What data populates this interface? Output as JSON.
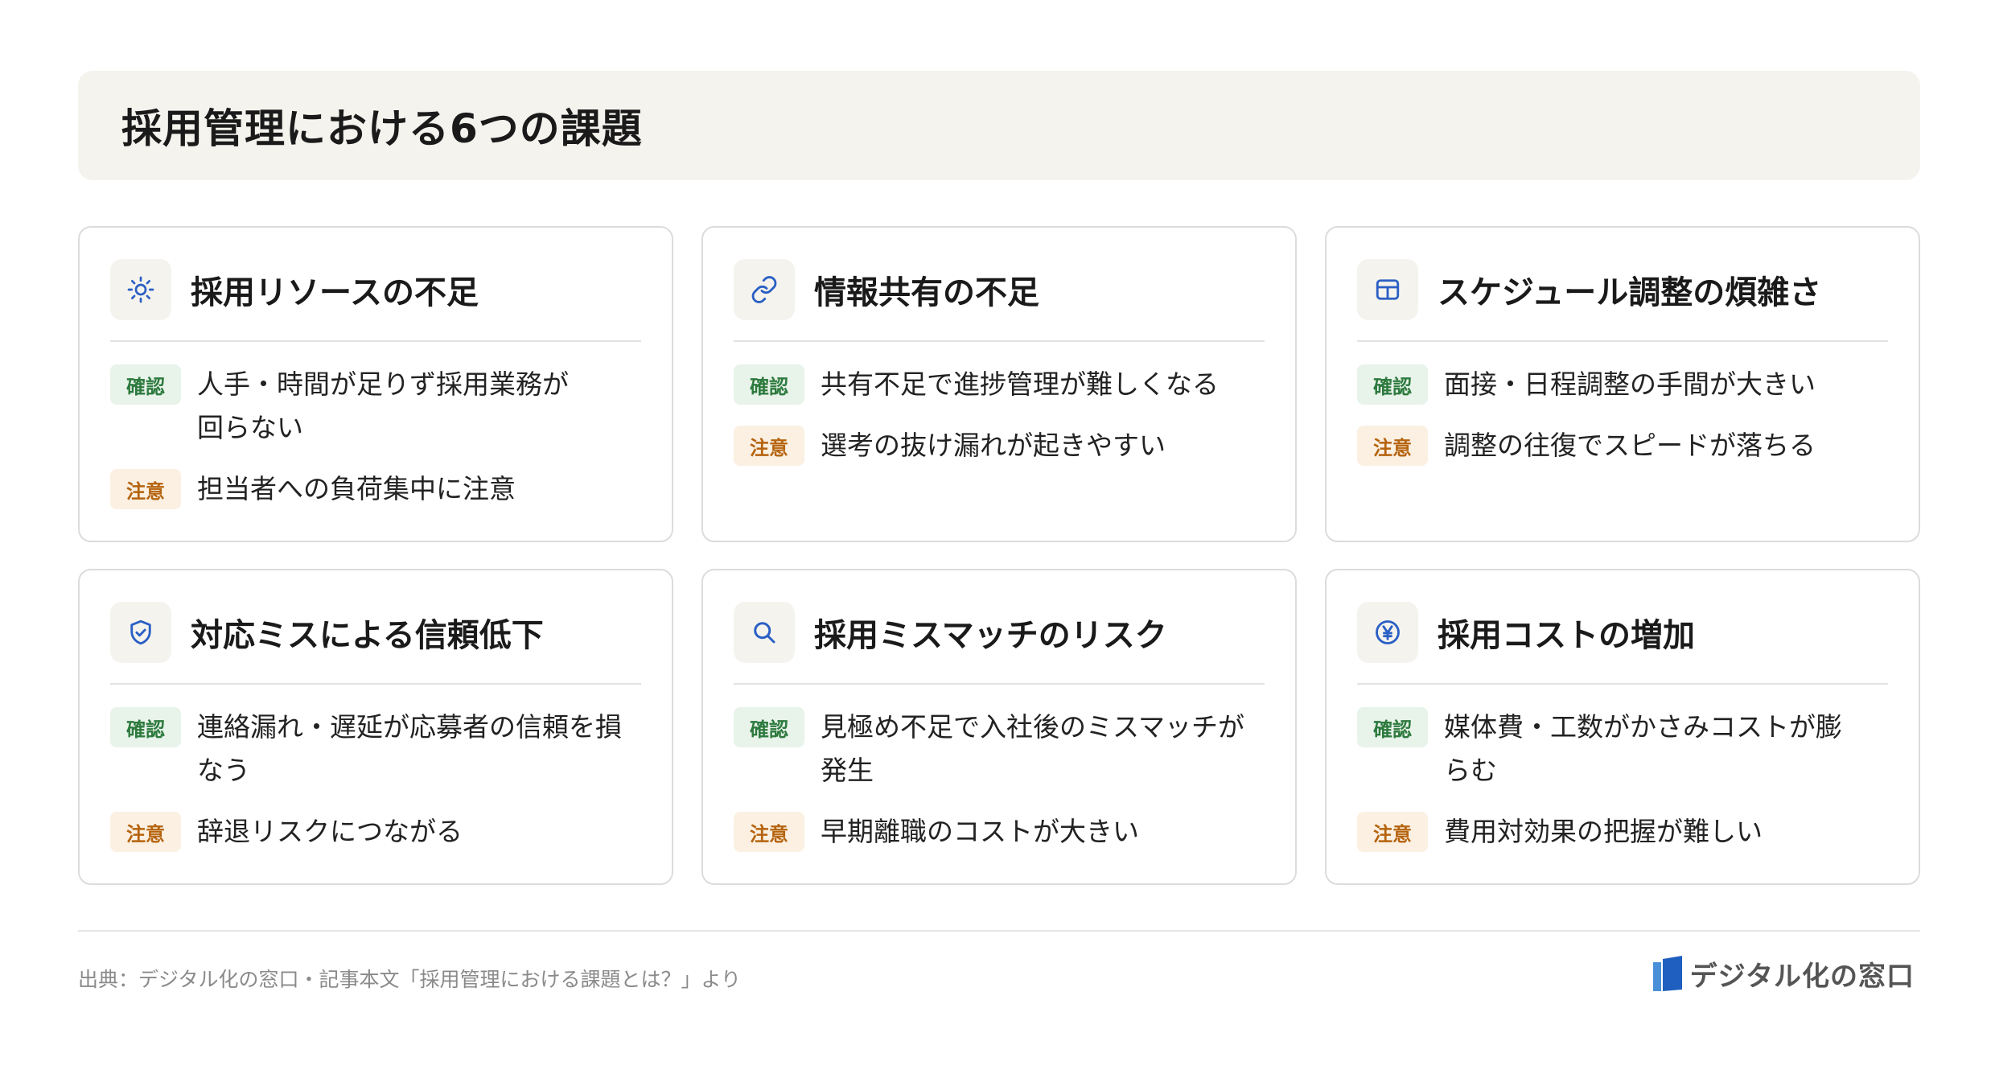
{
  "title": "採用管理における6つの課題",
  "badges": {
    "confirm": "確認",
    "caution": "注意"
  },
  "colors": {
    "icon": "#2a5fc4",
    "confirm_text": "#2d7a3e",
    "confirm_bg": "#e8f3ea",
    "caution_text": "#b5630e",
    "caution_bg": "#fbf0e2",
    "title_bg": "#f5f3ee"
  },
  "cards": [
    {
      "icon": "sun-icon",
      "title": "採用リソースの不足",
      "confirm": "人手・時間が足りず採用業務が回らない",
      "caution": "担当者への負荷集中に注意"
    },
    {
      "icon": "link-icon",
      "title": "情報共有の不足",
      "confirm": "共有不足で進捗管理が難しくなる",
      "caution": "選考の抜け漏れが起きやすい"
    },
    {
      "icon": "table-icon",
      "title": "スケジュール調整の煩雑さ",
      "confirm": "面接・日程調整の手間が大きい",
      "caution": "調整の往復でスピードが落ちる"
    },
    {
      "icon": "shield-check-icon",
      "title": "対応ミスによる信頼低下",
      "confirm": "連絡漏れ・遅延が応募者の信頼を損なう",
      "caution": "辞退リスクにつながる"
    },
    {
      "icon": "search-icon",
      "title": "採用ミスマッチのリスク",
      "confirm": "見極め不足で入社後のミスマッチが発生",
      "caution": "早期離職のコストが大きい"
    },
    {
      "icon": "yen-circle-icon",
      "title": "採用コストの増加",
      "confirm": "媒体費・工数がかさみコストが膨らむ",
      "caution": "費用対効果の把握が難しい"
    }
  ],
  "footer": {
    "source": "出典：デジタル化の窓口・記事本文「採用管理における課題とは？」より",
    "brand": "デジタル化の窓口"
  }
}
